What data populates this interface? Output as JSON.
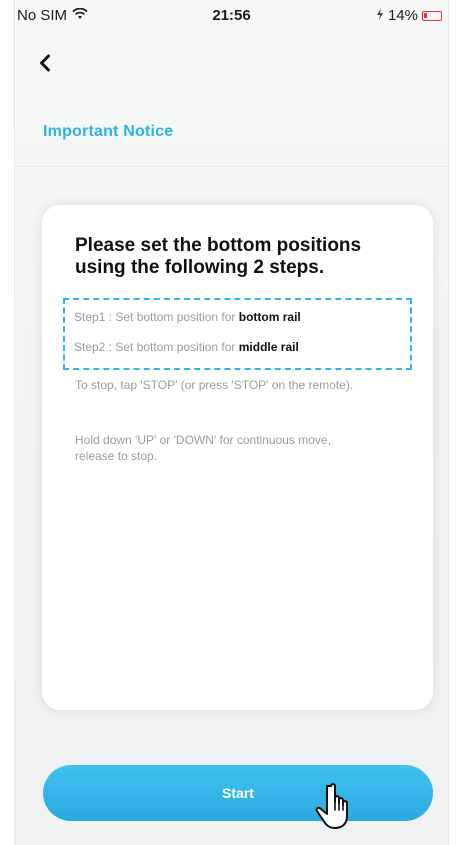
{
  "status_bar": {
    "carrier": "No SIM",
    "time": "21:56",
    "battery": "14%"
  },
  "header": {
    "title": "Important Notice"
  },
  "card": {
    "heading": "Please set the bottom positions using the following 2 steps.",
    "steps": [
      {
        "prefix": "Step1 : Set bottom position for ",
        "highlight": "bottom rail"
      },
      {
        "prefix": "Step2 : Set bottom position for ",
        "highlight": "middle rail"
      }
    ],
    "notes": [
      "To stop, tap 'STOP' (or press 'STOP' on the remote).",
      "Hold down 'UP' or 'DOWN' for continuous move, release to stop."
    ]
  },
  "footer": {
    "start_label": "Start"
  },
  "colors": {
    "accent": "#2fb3e6",
    "battery_low": "#e4323f"
  },
  "icons": {
    "back": "chevron-left-icon",
    "wifi": "wifi-icon",
    "battery": "battery-icon",
    "charging": "charging-icon",
    "pointer": "hand-pointer-icon"
  }
}
